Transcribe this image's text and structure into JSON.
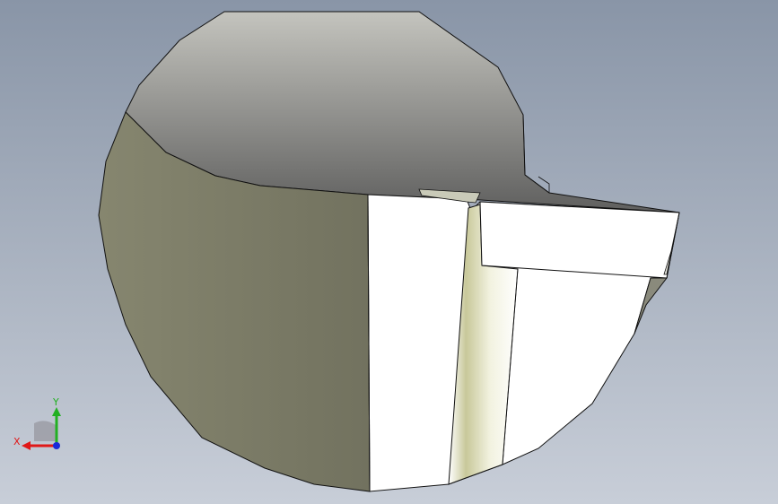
{
  "viewport": {
    "background_top": "#8a97a8",
    "background_bottom": "#c5cbd6"
  },
  "model": {
    "top_face_color_light": "#c2c2bc",
    "top_face_color_dark": "#6e6e6c",
    "side_face_color": "#7a7a6a",
    "section_face_color": "#ffffff",
    "edge_color": "#111111"
  },
  "triad": {
    "x_label": "X",
    "y_label": "Y",
    "x_color": "#e01818",
    "y_color": "#22b022",
    "z_color": "#1a2ad8"
  }
}
